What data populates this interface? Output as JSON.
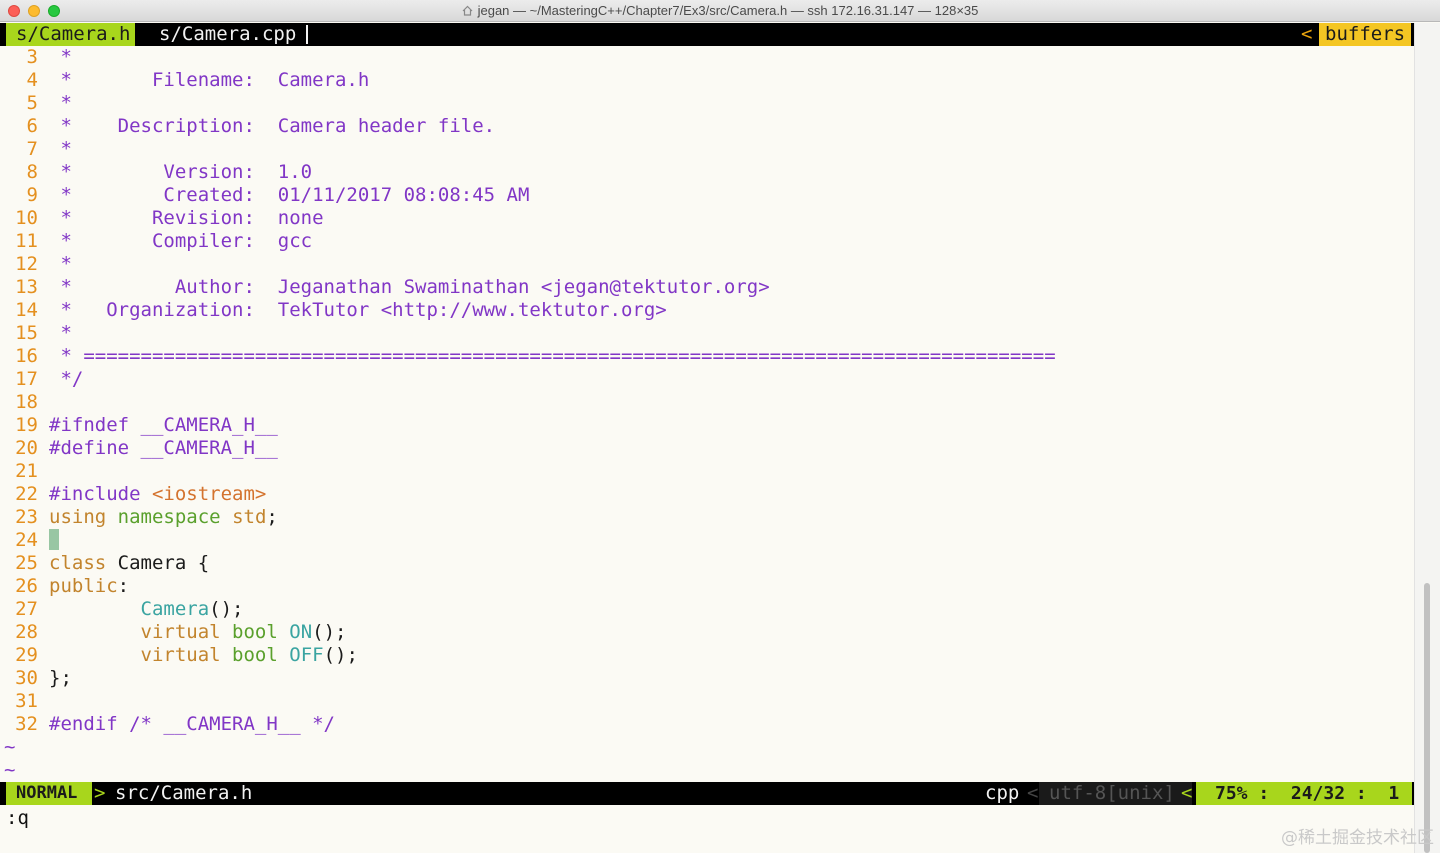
{
  "window": {
    "title": "jegan — ~/MasteringC++/Chapter7/Ex3/src/Camera.h — ssh 172.16.31.147 — 128×35"
  },
  "tabline": {
    "active_tab": "s/Camera.h",
    "inactive_tab": "s/Camera.cpp",
    "buffers_sep": "<",
    "buffers_label": "buffers"
  },
  "editor": {
    "lines": [
      {
        "n": "3",
        "text": " *"
      },
      {
        "n": "4",
        "text": " *       Filename:  Camera.h"
      },
      {
        "n": "5",
        "text": " *"
      },
      {
        "n": "6",
        "text": " *    Description:  Camera header file."
      },
      {
        "n": "7",
        "text": " *"
      },
      {
        "n": "8",
        "text": " *        Version:  1.0"
      },
      {
        "n": "9",
        "text": " *        Created:  01/11/2017 08:08:45 AM"
      },
      {
        "n": "10",
        "text": " *       Revision:  none"
      },
      {
        "n": "11",
        "text": " *       Compiler:  gcc"
      },
      {
        "n": "12",
        "text": " *"
      },
      {
        "n": "13",
        "text": " *         Author:  Jeganathan Swaminathan <jegan@tektutor.org>"
      },
      {
        "n": "14",
        "text": " *   Organization:  TekTutor <http://www.tektutor.org>"
      },
      {
        "n": "15",
        "text": " *"
      },
      {
        "n": "16",
        "text": " * ====================================================================================="
      },
      {
        "n": "17",
        "text": " */"
      },
      {
        "n": "18",
        "text": ""
      },
      {
        "n": "19",
        "kw": "#ifndef",
        "rest": " __CAMERA_H__"
      },
      {
        "n": "20",
        "kw": "#define",
        "rest": " __CAMERA_H__"
      },
      {
        "n": "21",
        "text": ""
      },
      {
        "n": "22",
        "kw": "#include",
        "inc": " <iostream>"
      },
      {
        "n": "23",
        "kw": "using",
        "kw2": "namespace",
        "rest": "std",
        "end": ";"
      },
      {
        "n": "24",
        "cursor": true
      },
      {
        "n": "25",
        "kw": "class",
        "rest": " Camera {"
      },
      {
        "n": "26",
        "kw": "public",
        "rest": ":"
      },
      {
        "n": "27",
        "indent": "        ",
        "fn": "Camera",
        "rest": "();"
      },
      {
        "n": "28",
        "indent": "        ",
        "kw": "virtual",
        "type": "bool",
        "fn": "ON",
        "rest": "();"
      },
      {
        "n": "29",
        "indent": "        ",
        "kw": "virtual",
        "type": "bool",
        "fn": "OFF",
        "rest": "();"
      },
      {
        "n": "30",
        "rest": "};"
      },
      {
        "n": "31",
        "text": ""
      },
      {
        "n": "32",
        "kw": "#endif",
        "com": " /* __CAMERA_H__ */"
      }
    ],
    "tilde_1": "~",
    "tilde_2": "~"
  },
  "statusline": {
    "mode": "NORMAL",
    "mode_sep": ">",
    "file": "src/Camera.h",
    "filetype": "cpp",
    "sep1": "<",
    "encoding": "utf-8[unix]",
    "sep2": "<",
    "position": "75% :  24/32 :  1"
  },
  "cmdline": ":q",
  "watermark": "@稀土掘金技术社区",
  "colors": {
    "accent_green": "#a8d61c",
    "accent_yellow": "#f4c623",
    "comment_purple": "#8136c6",
    "line_number_orange": "#e4901f"
  }
}
